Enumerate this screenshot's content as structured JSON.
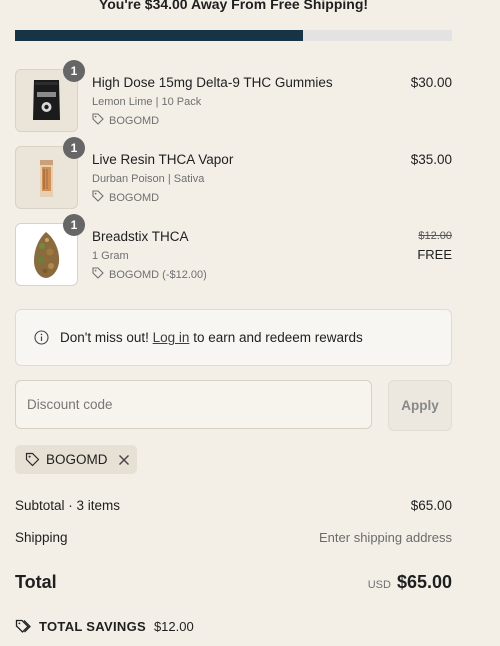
{
  "shipping": {
    "message": "You're $34.00 Away From Free Shipping!",
    "progress_fraction": 0.658
  },
  "items": [
    {
      "name": "High Dose 15mg Delta-9 THC Gummies",
      "variant": "Lemon Lime | 10 Pack",
      "discount": "BOGOMD",
      "price": "$30.00",
      "quantity": "1"
    },
    {
      "name": "Live Resin THCA Vapor",
      "variant": "Durban Poison | Sativa",
      "discount": "BOGOMD",
      "price": "$35.00",
      "quantity": "1"
    },
    {
      "name": "Breadstix THCA",
      "variant": "1 Gram",
      "discount": "BOGOMD (-$12.00)",
      "original_price": "$12.00",
      "price": "FREE",
      "quantity": "1"
    }
  ],
  "rewards_notice": {
    "prefix": "Don't miss out!",
    "link": "Log in",
    "suffix": "to earn and redeem rewards"
  },
  "discount": {
    "placeholder": "Discount code",
    "apply_label": "Apply",
    "applied_code": "BOGOMD"
  },
  "summary": {
    "subtotal_label": "Subtotal · 3 items",
    "subtotal_value": "$65.00",
    "shipping_label": "Shipping",
    "shipping_value": "Enter shipping address",
    "total_label": "Total",
    "currency": "USD",
    "total_value": "$65.00",
    "savings_label": "TOTAL SAVINGS",
    "savings_value": "$12.00"
  },
  "colors": {
    "background": "#f3efe7",
    "progress_fill": "#173447",
    "progress_track": "#e3e3e3",
    "badge": "#666666"
  }
}
